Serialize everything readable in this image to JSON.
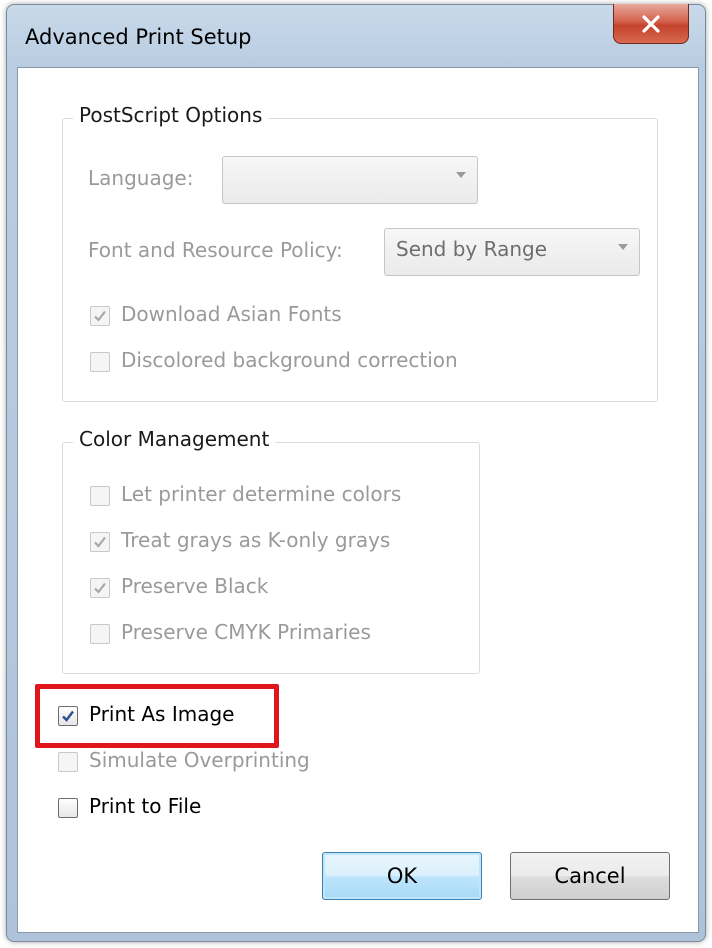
{
  "window": {
    "title": "Advanced Print Setup"
  },
  "postscript": {
    "group_title": "PostScript Options",
    "language_label": "Language:",
    "language_value": "",
    "font_policy_label": "Font and Resource Policy:",
    "font_policy_value": "Send by Range",
    "download_asian_fonts": {
      "label": "Download Asian Fonts",
      "checked": true,
      "enabled": false
    },
    "discolored_bg_correction": {
      "label": "Discolored background correction",
      "checked": false,
      "enabled": false
    }
  },
  "color_management": {
    "group_title": "Color Management",
    "let_printer": {
      "label": "Let printer determine colors",
      "checked": false,
      "enabled": false
    },
    "treat_grays": {
      "label": "Treat grays as K-only grays",
      "checked": true,
      "enabled": false
    },
    "preserve_black": {
      "label": "Preserve Black",
      "checked": true,
      "enabled": false
    },
    "preserve_cmyk": {
      "label": "Preserve CMYK Primaries",
      "checked": false,
      "enabled": false
    }
  },
  "options": {
    "print_as_image": {
      "label": "Print As Image",
      "checked": true,
      "enabled": true
    },
    "simulate_overprinting": {
      "label": "Simulate Overprinting",
      "checked": false,
      "enabled": false
    },
    "print_to_file": {
      "label": "Print to File",
      "checked": false,
      "enabled": true
    }
  },
  "buttons": {
    "ok_label": "OK",
    "cancel_label": "Cancel"
  },
  "colors": {
    "highlight": "#e0161c",
    "disabled_text": "#9a9a9a",
    "default_button_border": "#3c7fb1"
  },
  "icons": {
    "close": "close-icon",
    "dropdown": "chevron-down-icon",
    "check": "checkmark-icon"
  }
}
